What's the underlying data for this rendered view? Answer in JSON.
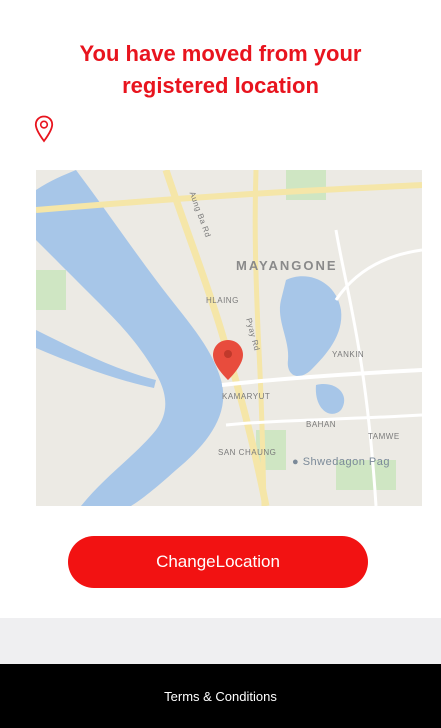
{
  "header": {
    "title_line1": "You have moved from your",
    "title_line2": "registered location"
  },
  "icons": {
    "location": "location-pin-icon"
  },
  "map": {
    "labels": {
      "mayangone": "MAYANGONE",
      "hlaing": "HLAING",
      "kamaryut": "KAMARYUT",
      "yankin": "YANKIN",
      "bahan": "BAHAN",
      "tamwe": "TAMWE",
      "sanchaung": "SAN CHAUNG",
      "shwedagon": "Shwedagon Pag",
      "road_a": "Aung Ba Rd",
      "road_b": "Pyay Rd"
    },
    "colors": {
      "water": "#a7c6e8",
      "land": "#eceae4",
      "road": "#f5e6a8",
      "park": "#cfe6c3",
      "pin": "#e84c3d"
    }
  },
  "actions": {
    "change_location_label": "ChangeLocation"
  },
  "footer": {
    "terms_label": "Terms & Conditions"
  },
  "colors": {
    "accent": "#e8141e",
    "button": "#f21212",
    "footer_bg": "#000000"
  }
}
